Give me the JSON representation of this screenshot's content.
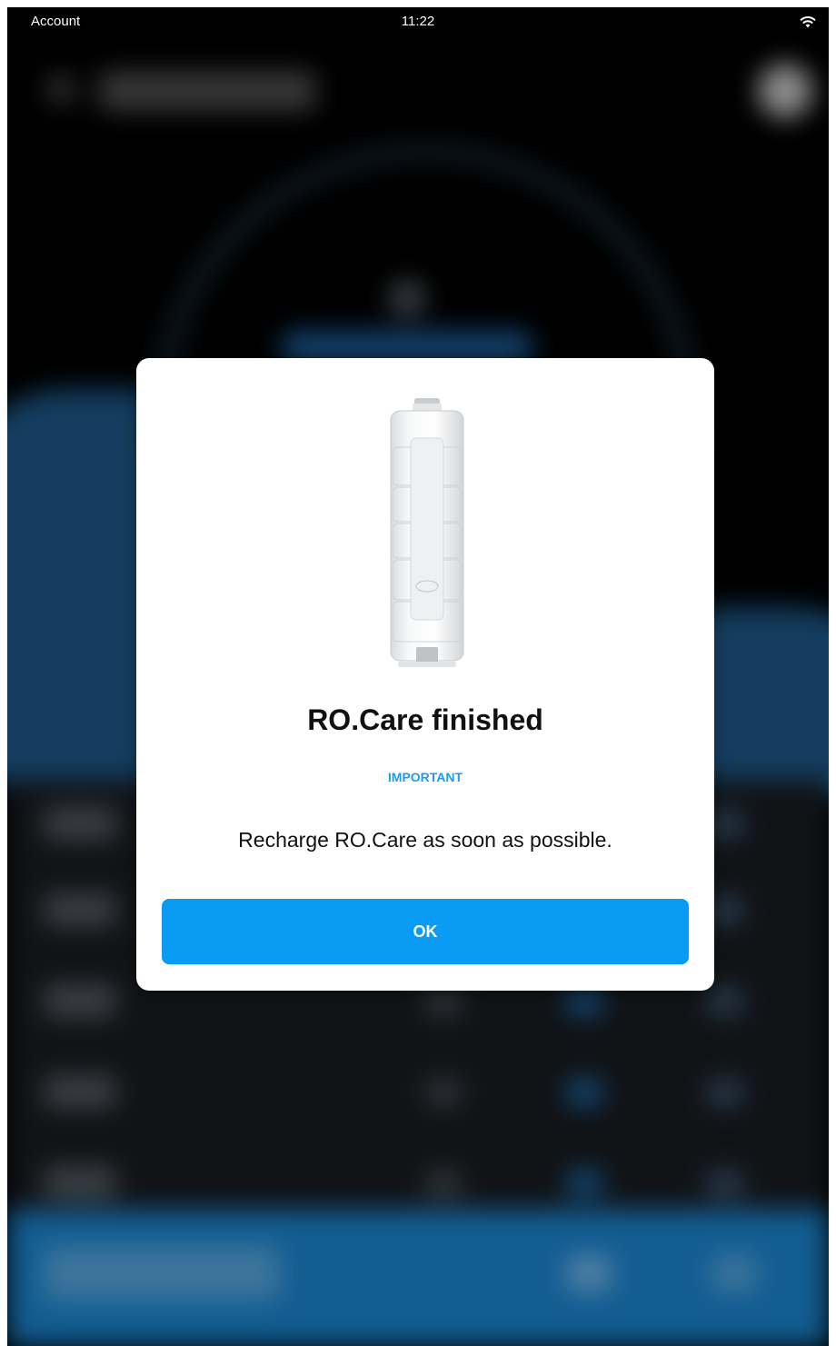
{
  "status_bar": {
    "left_label": "Account",
    "time": "11:22",
    "wifi_icon": "wifi-icon"
  },
  "dialog": {
    "image_icon": "ro-care-cartridge-image",
    "title": "RO.Care finished",
    "tag": "IMPORTANT",
    "message": "Recharge RO.Care as soon as possible.",
    "ok_label": "OK"
  },
  "colors": {
    "accent": "#0a9bf5",
    "tag": "#1e9bf0",
    "background": "#000000"
  }
}
